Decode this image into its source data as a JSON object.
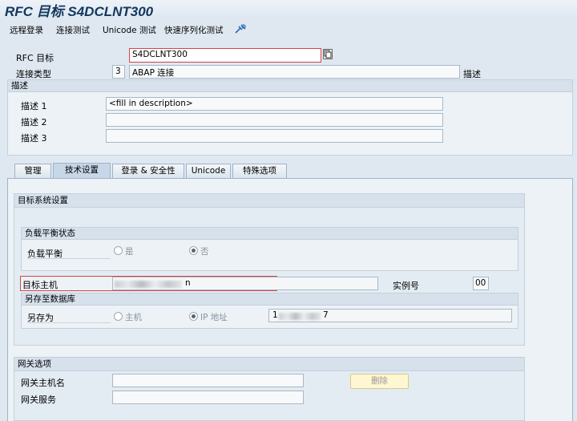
{
  "window": {
    "title": "RFC 目标 S4DCLNT300"
  },
  "toolbar": {
    "items": [
      "远程登录",
      "连接测试",
      "Unicode 测试",
      "快速序列化测试"
    ],
    "icon": "test-tools-icon"
  },
  "header": {
    "rfc_dest_label": "RFC 目标",
    "rfc_dest_value": "S4DCLNT300",
    "conn_type_label": "连接类型",
    "conn_type_code": "3",
    "conn_type_value": "ABAP 连接",
    "conn_type_desc_label": "描述"
  },
  "description": {
    "title": "描述",
    "fields": [
      {
        "label": "描述 1",
        "value": "<fill in description>"
      },
      {
        "label": "描述 2",
        "value": ""
      },
      {
        "label": "描述 3",
        "value": ""
      }
    ]
  },
  "tabs": [
    {
      "label": "管理",
      "active": false
    },
    {
      "label": "技术设置",
      "active": true
    },
    {
      "label": "登录 & 安全性",
      "active": false
    },
    {
      "label": "Unicode",
      "active": false
    },
    {
      "label": "特殊选项",
      "active": false
    }
  ],
  "target_system": {
    "title": "目标系统设置",
    "load_balance": {
      "title": "负载平衡状态",
      "label": "负载平衡",
      "option_yes": "是",
      "option_no": "否",
      "selected": "否"
    },
    "target_host_label": "目标主机",
    "target_host_visible_suffix": "n",
    "instance_label": "实例号",
    "instance_value": "00",
    "save_to_db": {
      "title": "另存至数据库",
      "label": "另存为",
      "option_host": "主机",
      "option_ip": "IP 地址",
      "selected": "IP 地址",
      "ip_prefix": "1",
      "ip_suffix": "7"
    }
  },
  "gateway": {
    "title": "网关选项",
    "host_label": "网关主机名",
    "service_label": "网关服务",
    "delete_button": "删除"
  }
}
